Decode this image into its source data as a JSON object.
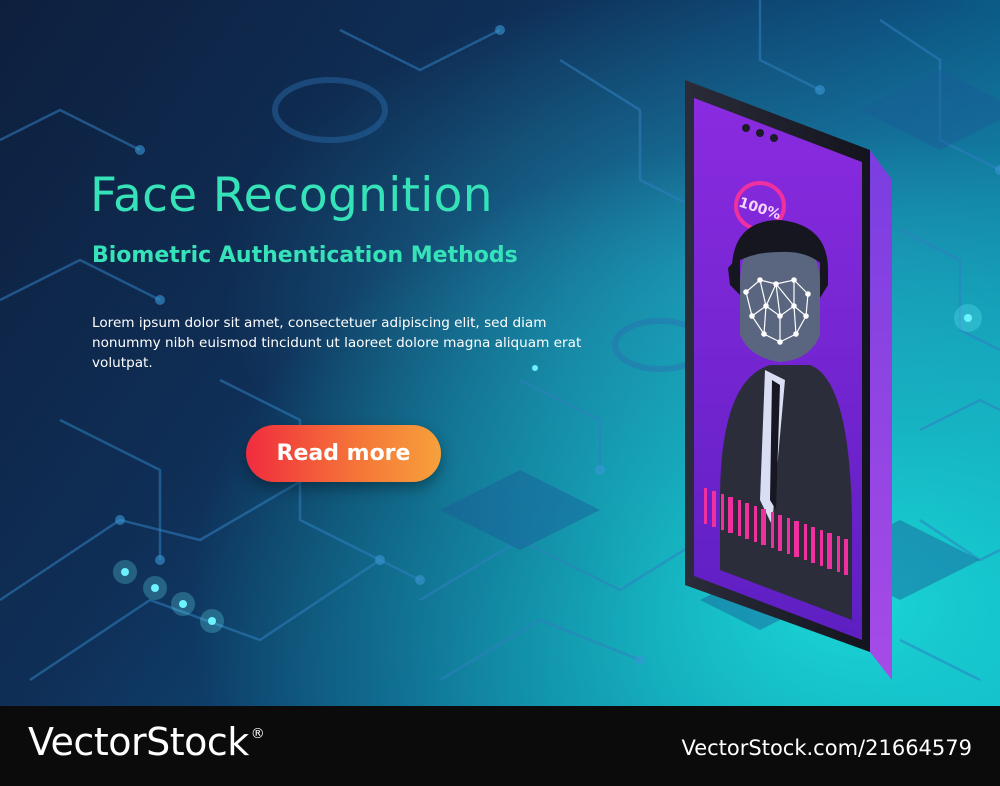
{
  "hero": {
    "title": "Face Recognition",
    "subtitle": "Biometric Authentication Methods",
    "body": "Lorem ipsum dolor sit amet, consectetuer adipiscing elit, sed diam nonummy nibh euismod tincidunt ut laoreet dolore magna aliquam erat volutpat.",
    "cta_label": "Read more"
  },
  "phone": {
    "scan_progress_label": "100%",
    "scan_progress": 1.0
  },
  "footer": {
    "logo_text": "VectorStock",
    "logo_mark": "®",
    "image_id": "VectorStock.com/21664579"
  },
  "colors": {
    "accent": "#36e3b9",
    "cta_start": "#f02c3e",
    "cta_end": "#f6a13b",
    "screen": "#7b2bd6",
    "ring": "#f0309e",
    "footer_bg": "#0b0b0b"
  },
  "icons": {
    "face_scan": "face-mesh-icon",
    "progress": "progress-ring-icon"
  }
}
